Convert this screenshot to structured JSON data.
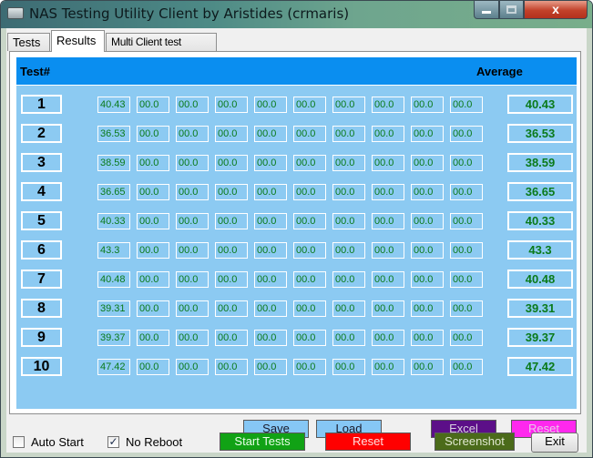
{
  "window": {
    "title": "NAS Testing Utility Client by Aristides (crmaris)",
    "close_glyph": "x"
  },
  "tabs": [
    "Tests",
    "Results",
    "Multi Client test"
  ],
  "active_tab": "Results",
  "table": {
    "header_test": "Test#",
    "header_average": "Average",
    "rows": [
      {
        "num": "1",
        "cells": [
          "40.43",
          "00.0",
          "00.0",
          "00.0",
          "00.0",
          "00.0",
          "00.0",
          "00.0",
          "00.0",
          "00.0"
        ],
        "average": "40.43"
      },
      {
        "num": "2",
        "cells": [
          "36.53",
          "00.0",
          "00.0",
          "00.0",
          "00.0",
          "00.0",
          "00.0",
          "00.0",
          "00.0",
          "00.0"
        ],
        "average": "36.53"
      },
      {
        "num": "3",
        "cells": [
          "38.59",
          "00.0",
          "00.0",
          "00.0",
          "00.0",
          "00.0",
          "00.0",
          "00.0",
          "00.0",
          "00.0"
        ],
        "average": "38.59"
      },
      {
        "num": "4",
        "cells": [
          "36.65",
          "00.0",
          "00.0",
          "00.0",
          "00.0",
          "00.0",
          "00.0",
          "00.0",
          "00.0",
          "00.0"
        ],
        "average": "36.65"
      },
      {
        "num": "5",
        "cells": [
          "40.33",
          "00.0",
          "00.0",
          "00.0",
          "00.0",
          "00.0",
          "00.0",
          "00.0",
          "00.0",
          "00.0"
        ],
        "average": "40.33"
      },
      {
        "num": "6",
        "cells": [
          "43.3",
          "00.0",
          "00.0",
          "00.0",
          "00.0",
          "00.0",
          "00.0",
          "00.0",
          "00.0",
          "00.0"
        ],
        "average": "43.3"
      },
      {
        "num": "7",
        "cells": [
          "40.48",
          "00.0",
          "00.0",
          "00.0",
          "00.0",
          "00.0",
          "00.0",
          "00.0",
          "00.0",
          "00.0"
        ],
        "average": "40.48"
      },
      {
        "num": "8",
        "cells": [
          "39.31",
          "00.0",
          "00.0",
          "00.0",
          "00.0",
          "00.0",
          "00.0",
          "00.0",
          "00.0",
          "00.0"
        ],
        "average": "39.31"
      },
      {
        "num": "9",
        "cells": [
          "39.37",
          "00.0",
          "00.0",
          "00.0",
          "00.0",
          "00.0",
          "00.0",
          "00.0",
          "00.0",
          "00.0"
        ],
        "average": "39.37"
      },
      {
        "num": "10",
        "cells": [
          "47.42",
          "00.0",
          "00.0",
          "00.0",
          "00.0",
          "00.0",
          "00.0",
          "00.0",
          "00.0",
          "00.0"
        ],
        "average": "47.42"
      }
    ]
  },
  "panel_buttons": {
    "save": "Save",
    "load": "Load",
    "excel": "Excel",
    "reset": "Reset"
  },
  "options": {
    "auto_start_label": "Auto Start",
    "auto_start_checked": false,
    "no_reboot_label": "No Reboot",
    "no_reboot_checked": true,
    "check_glyph": "✓"
  },
  "bottom_buttons": {
    "start": "Start Tests",
    "reset": "Reset",
    "screenshot": "Screenshot",
    "exit": "Exit"
  },
  "colors": {
    "header_blue": "#0a8ef0",
    "grid_blue": "#8ccaf2",
    "value_green": "#0a7a1a",
    "start_green": "#11a215",
    "reset_red": "#ff0000",
    "excel_purple": "#5c0f88",
    "reset_magenta": "#ff28ee",
    "screenshot_olive": "#4b6b1a"
  }
}
